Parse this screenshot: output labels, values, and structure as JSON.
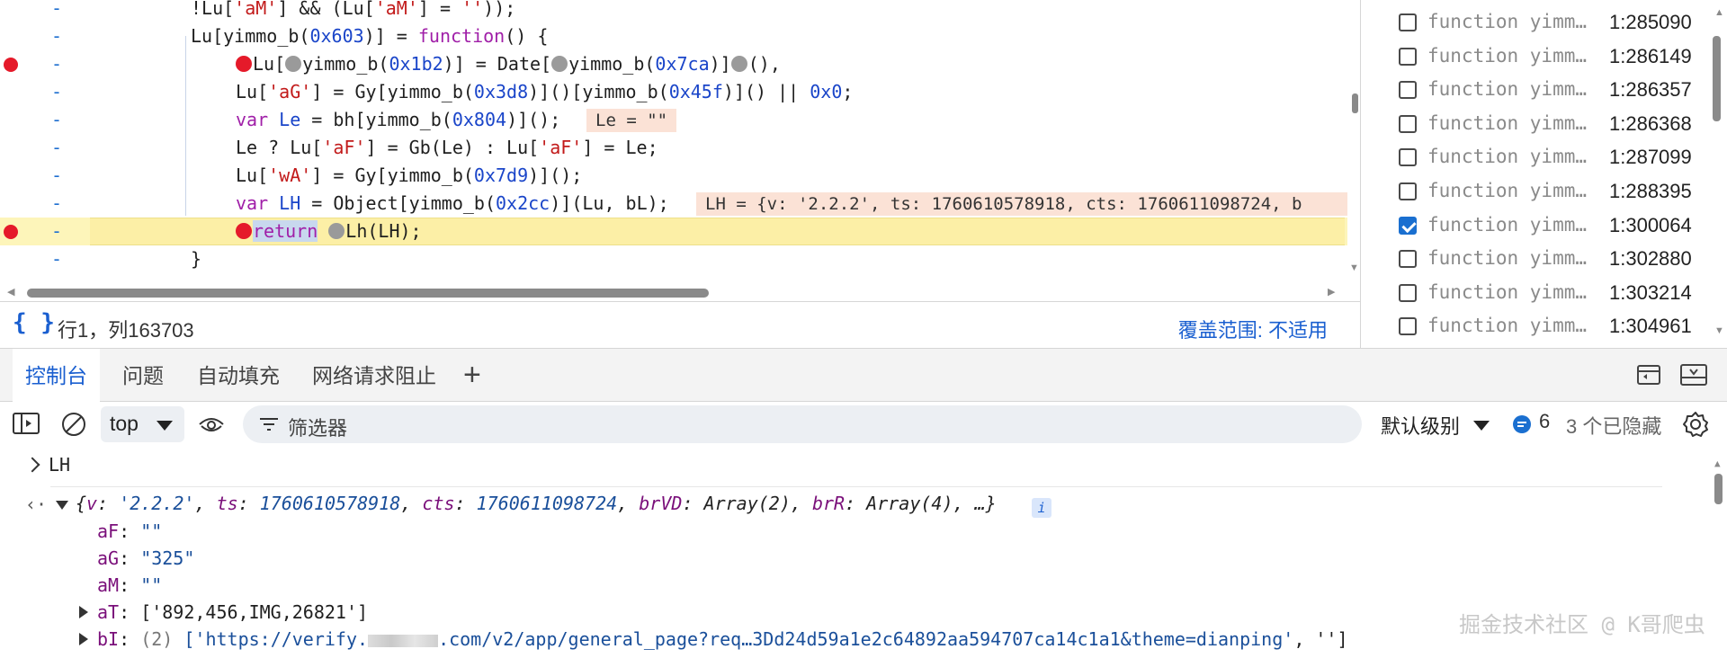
{
  "editor": {
    "lines": [
      {
        "breakpoint": false,
        "html_parts": [
          {
            "t": "!Lu[",
            "c": ""
          },
          {
            "t": "'aM'",
            "c": "str"
          },
          {
            "t": "] && (Lu[",
            "c": ""
          },
          {
            "t": "'aM'",
            "c": "str"
          },
          {
            "t": "] = ",
            "c": ""
          },
          {
            "t": "''",
            "c": "str"
          },
          {
            "t": "));",
            "c": ""
          }
        ],
        "indent": 1
      },
      {
        "breakpoint": false,
        "indent": 1
      },
      {
        "breakpoint": true,
        "indent": 2
      },
      {
        "breakpoint": false,
        "indent": 2
      },
      {
        "breakpoint": false,
        "indent": 2
      },
      {
        "breakpoint": false,
        "indent": 2
      },
      {
        "breakpoint": false,
        "indent": 2
      },
      {
        "breakpoint": false,
        "indent": 2
      },
      {
        "breakpoint": true,
        "indent": 2,
        "paused": true
      },
      {
        "breakpoint": false,
        "indent": 1
      }
    ],
    "gutter_marker": "-",
    "line1_a": "!Lu[",
    "line1_b": "'aM'",
    "line1_c": "] && (Lu[",
    "line1_d": "'aM'",
    "line1_e": "] = ",
    "line1_f": "''",
    "line1_g": "));",
    "line2_a": "Lu[yimmo_b(",
    "line2_b": "0x603",
    "line2_c": ")] = ",
    "line2_d": "function",
    "line2_e": "() {",
    "line3_a": "Lu[",
    "line3_b": "yimmo_b(",
    "line3_c": "0x1b2",
    "line3_d": ")] = Date[",
    "line3_e": "yimmo_b(",
    "line3_f": "0x7ca",
    "line3_g": ")]",
    "line3_h": "(),",
    "line4_a": "Lu[",
    "line4_b": "'aG'",
    "line4_c": "] = Gy[yimmo_b(",
    "line4_d": "0x3d8",
    "line4_e": ")]()[yimmo_b(",
    "line4_f": "0x45f",
    "line4_g": ")]() || ",
    "line4_h": "0x0",
    "line4_i": ";",
    "line5_a": "var ",
    "line5_b": "Le",
    "line5_c": " = bh[yimmo_b(",
    "line5_d": "0x804",
    "line5_e": ")]();",
    "line5_inline": "Le = \"\"",
    "line6": "Le ? Lu[",
    "line6_b": "'aF'",
    "line6_c": "] = Gb(Le) : Lu[",
    "line6_d": "'aF'",
    "line6_e": "] = Le;",
    "line7_a": "Lu[",
    "line7_b": "'wA'",
    "line7_c": "] = Gy[yimmo_b(",
    "line7_d": "0x7d9",
    "line7_e": ")]();",
    "line8_a": "var ",
    "line8_b": "LH",
    "line8_c": " = Object[yimmo_b(",
    "line8_d": "0x2cc",
    "line8_e": ")](Lu, bL);",
    "line8_inline": "LH = {v: '2.2.2', ts: 1760610578918, cts: 1760611098724, b",
    "line9_a": "return",
    "line9_b": "Lh(LH);",
    "line10": "}"
  },
  "status_bar": {
    "cursor_position": "行1，列163703",
    "coverage": "覆盖范围: 不适用"
  },
  "breakpoints": [
    {
      "label": "function yimm…",
      "location": "1:285090",
      "checked": false
    },
    {
      "label": "function yimm…",
      "location": "1:286149",
      "checked": false
    },
    {
      "label": "function yimm…",
      "location": "1:286357",
      "checked": false
    },
    {
      "label": "function yimm…",
      "location": "1:286368",
      "checked": false
    },
    {
      "label": "function yimm…",
      "location": "1:287099",
      "checked": false
    },
    {
      "label": "function yimm…",
      "location": "1:288395",
      "checked": false
    },
    {
      "label": "function yimm…",
      "location": "1:300064",
      "checked": true
    },
    {
      "label": "function yimm…",
      "location": "1:302880",
      "checked": false
    },
    {
      "label": "function yimm…",
      "location": "1:303214",
      "checked": false
    },
    {
      "label": "function yimm…",
      "location": "1:304961",
      "checked": false
    }
  ],
  "drawer": {
    "tabs": [
      "控制台",
      "问题",
      "自动填充",
      "网络请求阻止"
    ],
    "add_tab": "+"
  },
  "console_toolbar": {
    "context": "top",
    "filter_placeholder": "筛选器",
    "levels": "默认级别",
    "issues_count": "6",
    "hidden": "3 个已隐藏"
  },
  "console": {
    "input": "LH",
    "summary_parts": {
      "open": "{",
      "k1": "v",
      "v1": "'2.2.2'",
      "k2": "ts",
      "v2": "1760610578918",
      "k3": "cts",
      "v3": "1760611098724",
      "k4": "brVD",
      "v4": "Array(2)",
      "k5": "brR",
      "v5": "Array(4)",
      "tail": "…}"
    },
    "info_badge": "i",
    "properties": [
      {
        "key": "aF",
        "value": "\"\""
      },
      {
        "key": "aG",
        "value": "\"325\""
      },
      {
        "key": "aM",
        "value": "\"\""
      },
      {
        "key": "aT",
        "value": "['892,456,IMG,26821']"
      },
      {
        "key": "bI",
        "count": "(2)",
        "value_a": "['https://verify.",
        "value_b": ".com/v2/app/general_page?req…3Dd24d59a1e2c64892aa594707ca14c1a1&theme=dianping'",
        "value_c": ", '']"
      }
    ],
    "watermark": "掘金技术社区 @ K哥爬虫"
  },
  "colors": {
    "accent": "#1a5fd0",
    "breakpoint": "#e51a2a",
    "paused_line": "#fdf5ba",
    "inline_value_bg": "#fbe2d6"
  }
}
